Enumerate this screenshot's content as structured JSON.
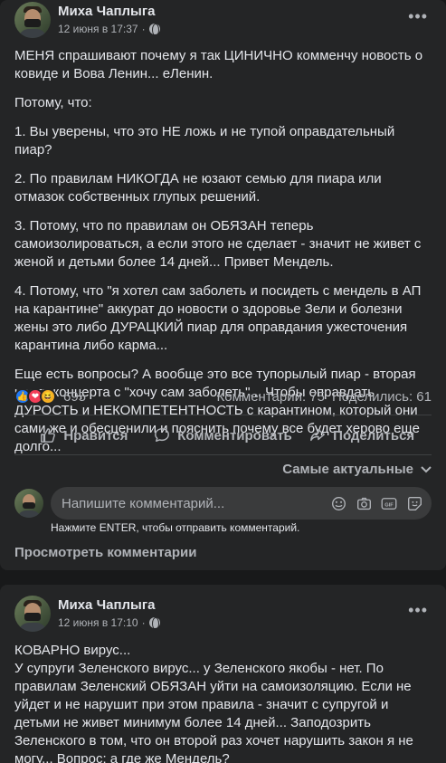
{
  "posts": [
    {
      "author": "Миха Чаплыга",
      "timestamp": "12 июня в 17:37",
      "paragraphs": [
        "МЕНЯ спрашивают почему я так ЦИНИЧНО комменчу новость о ковиде и Вова Ленин... еЛенин.",
        "Потому, что:",
        "1. Вы уверены, что это НЕ ложь и не тупой оправдательный пиар?",
        "2. По правилам НИКОГДА не юзают семью для пиара или отмазок собственных глупых решений.",
        "3. Потому, что по правилам он ОБЯЗАН теперь самоизолироваться, а если этого не сделает - значит не живет с женой и детьми более 14 дней... Привет Мендель.",
        "4. Потому, что \"я хотел сам заболеть и посидеть с мендель в АП на карантине\" аккурат до новости о здоровье Зели и болезни жены это либо ДУРАЦКИЙ пиар для оправдания ужесточения карантина либо карма...",
        "Еще есть вопросы? А вообще это все тупорылый пиар - вторая часть концерта с \"хочу сам заболеть\"... Чтобы оправдать ДУРОСТЬ и НЕКОМПЕТЕНТНОСТЬ с карантином, который они сами же и обесценили и пояснить почему все будет херово еще долго..."
      ],
      "reactions_count": "695",
      "comments_stat": "Комментарии: 75",
      "shares_stat": "Поделились: 61",
      "actions": {
        "like": "Нравится",
        "comment": "Комментировать",
        "share": "Поделиться"
      },
      "sort_label": "Самые актуальные",
      "comment_placeholder": "Напишите комментарий...",
      "enter_hint": "Нажмите ENTER, чтобы отправить комментарий.",
      "view_comments": "Просмотреть комментарии"
    },
    {
      "author": "Миха Чаплыга",
      "timestamp": "12 июня в 17:10",
      "paragraphs": [
        "КОВАРНО вирус...",
        "У супруги Зеленского вирус... у Зеленского якобы - нет. По правилам Зеленский ОБЯЗАН уйти на самоизоляцию. Если не уйдет и не нарушит при этом правила - значит с супругой и детьми не живет минимум более 14 дней... Заподозрить Зеленского в том, что он второй раз хочет нарушить закон я не могу... Вопрос: а где же Мендель?"
      ]
    }
  ],
  "colors": {
    "background": "#18191a",
    "card": "#242526",
    "text": "#e4e6eb",
    "secondary_text": "#b0b3b8",
    "like_blue": "#2078f4",
    "love_red": "#f33e58",
    "haha_yellow": "#f7b125"
  }
}
